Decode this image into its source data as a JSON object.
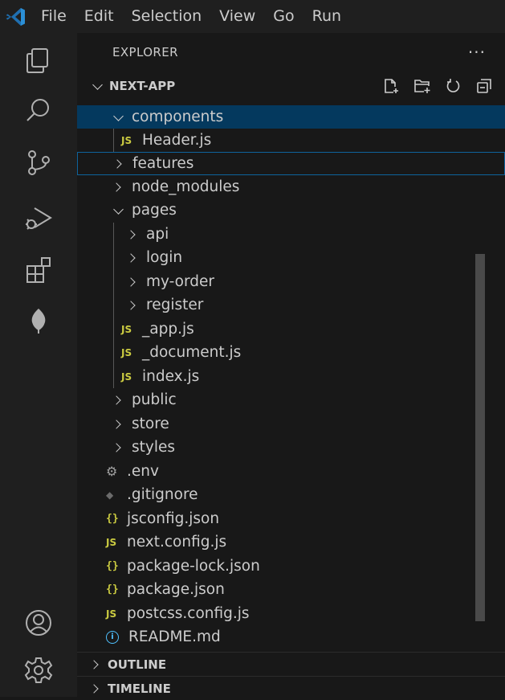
{
  "menu": [
    "File",
    "Edit",
    "Selection",
    "View",
    "Go",
    "Run"
  ],
  "explorer": {
    "title": "EXPLORER",
    "more": "···",
    "root": "NEXT-APP"
  },
  "tree": [
    {
      "label": "components",
      "kind": "folder-open",
      "depth": 1,
      "selected": true
    },
    {
      "label": "Header.js",
      "kind": "js",
      "depth": 2,
      "icon": "JS"
    },
    {
      "label": "features",
      "kind": "folder",
      "depth": 1,
      "focused": true
    },
    {
      "label": "node_modules",
      "kind": "folder",
      "depth": 1
    },
    {
      "label": "pages",
      "kind": "folder-open",
      "depth": 1
    },
    {
      "label": "api",
      "kind": "folder",
      "depth": 2
    },
    {
      "label": "login",
      "kind": "folder",
      "depth": 2
    },
    {
      "label": "my-order",
      "kind": "folder",
      "depth": 2
    },
    {
      "label": "register",
      "kind": "folder",
      "depth": 2
    },
    {
      "label": "_app.js",
      "kind": "js",
      "depth": 2,
      "icon": "JS"
    },
    {
      "label": "_document.js",
      "kind": "js",
      "depth": 2,
      "icon": "JS"
    },
    {
      "label": "index.js",
      "kind": "js",
      "depth": 2,
      "icon": "JS"
    },
    {
      "label": "public",
      "kind": "folder",
      "depth": 1
    },
    {
      "label": "store",
      "kind": "folder",
      "depth": 1
    },
    {
      "label": "styles",
      "kind": "folder",
      "depth": 1
    },
    {
      "label": ".env",
      "kind": "env",
      "depth": 1
    },
    {
      "label": ".gitignore",
      "kind": "git",
      "depth": 1
    },
    {
      "label": "jsconfig.json",
      "kind": "json",
      "depth": 1,
      "icon": "{}"
    },
    {
      "label": "next.config.js",
      "kind": "js",
      "depth": 1,
      "icon": "JS"
    },
    {
      "label": "package-lock.json",
      "kind": "json",
      "depth": 1,
      "icon": "{}"
    },
    {
      "label": "package.json",
      "kind": "json",
      "depth": 1,
      "icon": "{}"
    },
    {
      "label": "postcss.config.js",
      "kind": "js",
      "depth": 1,
      "icon": "JS"
    },
    {
      "label": "README.md",
      "kind": "info",
      "depth": 1
    }
  ],
  "sections": {
    "outline": "OUTLINE",
    "timeline": "TIMELINE"
  },
  "icons": {
    "env": "gear-icon",
    "git": "git-diamond-icon",
    "info": "info-icon",
    "info_glyph": "i"
  }
}
